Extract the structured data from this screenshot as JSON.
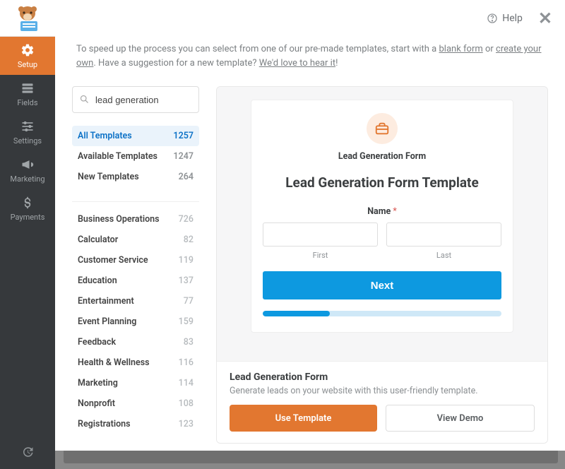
{
  "topbar": {
    "help_label": "Help"
  },
  "intro": {
    "prefix": "To speed up the process you can select from one of our pre-made templates, start with a ",
    "blank_form": "blank form",
    "or": " or ",
    "create_own": "create your own",
    "suffix1": ". Have a suggestion for a new template? ",
    "hear_it": "We'd love to hear it",
    "suffix2": "!"
  },
  "nav": {
    "setup": "Setup",
    "fields": "Fields",
    "settings": "Settings",
    "marketing": "Marketing",
    "payments": "Payments"
  },
  "search": {
    "value": "lead generation"
  },
  "filters": [
    {
      "label": "All Templates",
      "count": "1257",
      "selected": true
    },
    {
      "label": "Available Templates",
      "count": "1247",
      "selected": false
    },
    {
      "label": "New Templates",
      "count": "264",
      "selected": false
    }
  ],
  "categories": [
    {
      "label": "Business Operations",
      "count": "726"
    },
    {
      "label": "Calculator",
      "count": "82"
    },
    {
      "label": "Customer Service",
      "count": "119"
    },
    {
      "label": "Education",
      "count": "137"
    },
    {
      "label": "Entertainment",
      "count": "77"
    },
    {
      "label": "Event Planning",
      "count": "159"
    },
    {
      "label": "Feedback",
      "count": "83"
    },
    {
      "label": "Health & Wellness",
      "count": "116"
    },
    {
      "label": "Marketing",
      "count": "114"
    },
    {
      "label": "Nonprofit",
      "count": "108"
    },
    {
      "label": "Registrations",
      "count": "123"
    }
  ],
  "preview": {
    "small_title": "Lead Generation Form",
    "big_title": "Lead Generation Form Template",
    "name_label": "Name",
    "required_mark": "*",
    "first_sub": "First",
    "last_sub": "Last",
    "next_btn": "Next",
    "progress_pct": 28
  },
  "action": {
    "title": "Lead Generation Form",
    "desc": "Generate leads on your website with this user-friendly template.",
    "use_template": "Use Template",
    "view_demo": "View Demo"
  },
  "colors": {
    "accent": "#e27730",
    "link": "#0d72c7",
    "primary_blue": "#0d99e0"
  }
}
